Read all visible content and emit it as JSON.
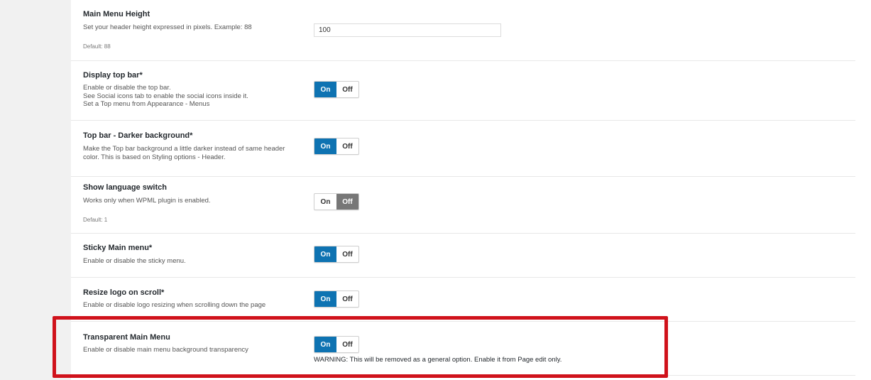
{
  "settings": {
    "main_menu_height": {
      "title": "Main Menu Height",
      "description": [
        "Set your header height expressed in pixels. Example: 88"
      ],
      "default": "Default: 88",
      "value": "100"
    },
    "display_top_bar": {
      "title": "Display top bar*",
      "description": [
        "Enable or disable the top bar.",
        "See Social icons tab to enable the social icons inside it.",
        "Set a Top menu from Appearance - Menus"
      ],
      "toggle": {
        "on_label": "On",
        "off_label": "Off",
        "state": "on"
      }
    },
    "top_bar_darker": {
      "title": "Top bar - Darker background*",
      "description": [
        "Make the Top bar background a little darker instead of same header",
        "color. This is based on Styling options - Header."
      ],
      "toggle": {
        "on_label": "On",
        "off_label": "Off",
        "state": "on"
      }
    },
    "language_switch": {
      "title": "Show language switch",
      "description": [
        "Works only when WPML plugin is enabled."
      ],
      "default": "Default: 1",
      "toggle": {
        "on_label": "On",
        "off_label": "Off",
        "state": "off"
      }
    },
    "sticky_menu": {
      "title": "Sticky Main menu*",
      "description": [
        "Enable or disable the sticky menu."
      ],
      "toggle": {
        "on_label": "On",
        "off_label": "Off",
        "state": "on"
      }
    },
    "resize_logo": {
      "title": "Resize logo on scroll*",
      "description": [
        "Enable or disable logo resizing when scrolling down the page"
      ],
      "toggle": {
        "on_label": "On",
        "off_label": "Off",
        "state": "on"
      }
    },
    "transparent_menu": {
      "title": "Transparent Main Menu",
      "description": [
        "Enable or disable main menu background transparency"
      ],
      "toggle": {
        "on_label": "On",
        "off_label": "Off",
        "state": "on"
      },
      "warning": "WARNING: This will be removed as a general option. Enable it from Page edit only."
    }
  },
  "colors": {
    "toggle_active_on": "#0e73b2",
    "toggle_active_off": "#777777",
    "highlight_border": "#d0121b"
  }
}
